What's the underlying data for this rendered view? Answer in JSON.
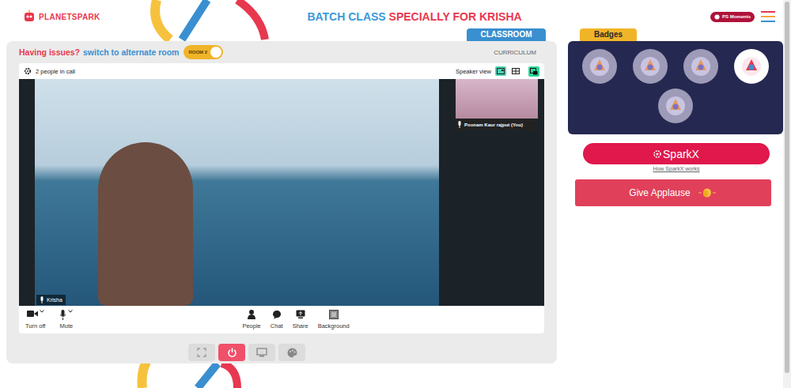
{
  "header": {
    "logo": "PLANETSPARK",
    "title_prefix": "BATCH CLASS",
    "title_highlight": "SPECIALLY FOR KRISHA",
    "moments": "PS Moments"
  },
  "classroom": {
    "tab": "CLASSROOM",
    "curriculum": "CURRICULUM",
    "issue_text": "Having issues?",
    "switch_text": "switch to alternate room",
    "room_toggle": {
      "label": "ROOM 2",
      "on": true
    }
  },
  "call": {
    "people": "2 people in call",
    "view_label": "Speaker view",
    "views": [
      {
        "kind": "speaker",
        "selected": true
      },
      {
        "kind": "grid",
        "selected": false
      }
    ],
    "main": {
      "name": "Krisha"
    },
    "thumbnail": {
      "name": "Poonam Kaur rajput (You)"
    }
  },
  "controls_left": [
    {
      "label": "Turn off",
      "kind": "camera"
    },
    {
      "label": "Mute",
      "kind": "mic"
    }
  ],
  "controls_center": [
    {
      "label": "People",
      "kind": "people"
    },
    {
      "label": "Chat",
      "kind": "chat"
    },
    {
      "label": "Share",
      "kind": "share"
    },
    {
      "label": "Background",
      "kind": "background"
    }
  ],
  "toolbar": [
    {
      "kind": "fullscreen",
      "selected": false
    },
    {
      "kind": "power",
      "selected": true
    },
    {
      "kind": "screen",
      "selected": false
    },
    {
      "kind": "palette",
      "selected": false
    }
  ],
  "badges": {
    "title": "Badges",
    "items": [
      {
        "selected": false
      },
      {
        "selected": false
      },
      {
        "selected": false
      },
      {
        "selected": true
      },
      {
        "selected": false
      }
    ]
  },
  "sparkx": {
    "label": "SparkX",
    "help": "How SparkX works"
  },
  "applause": {
    "label": "Give Applause"
  }
}
